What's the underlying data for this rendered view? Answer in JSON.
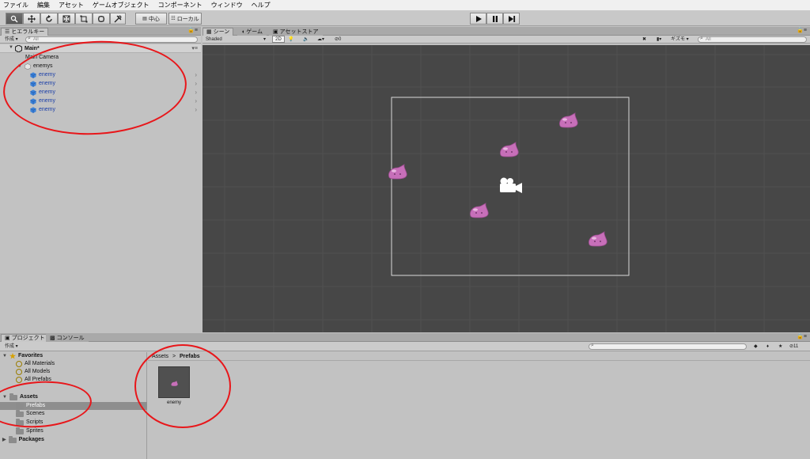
{
  "menubar": [
    "ファイル",
    "編集",
    "アセット",
    "ゲームオブジェクト",
    "コンポーネント",
    "ウィンドウ",
    "ヘルプ"
  ],
  "toolbar": {
    "pivot_label": "中心",
    "space_label": "ローカル",
    "play_icon": "play-icon",
    "pause_icon": "pause-icon",
    "step_icon": "step-icon"
  },
  "hierarchy": {
    "tab_label": "ヒエラルキー",
    "create_label": "作成",
    "search_placeholder": "All",
    "scene_name": "Main*",
    "items": [
      "Main Camera",
      "enemys",
      "enemy",
      "enemy",
      "enemy",
      "enemy",
      "enemy"
    ]
  },
  "scene_view": {
    "tabs": [
      "シーン",
      "ゲーム",
      "アセットストア"
    ],
    "shading": "Shaded",
    "mode_2d": "2D",
    "gizmo_value": "0",
    "gizmos_label": "ギズモ",
    "search_placeholder": "All"
  },
  "project": {
    "tabs": [
      "プロジェクト",
      "コンソール"
    ],
    "create_label": "作成",
    "hidden_count": "11",
    "favorites_label": "Favorites",
    "favorites": [
      "All Materials",
      "All Models",
      "All Prefabs"
    ],
    "assets_label": "Assets",
    "asset_folders": [
      "Prefabs",
      "Scenes",
      "Scripts",
      "Sprites"
    ],
    "packages_label": "Packages",
    "breadcrumb": [
      "Assets",
      "Prefabs"
    ],
    "breadcrumb_sep": ">",
    "prefab_name": "enemy"
  },
  "colors": {
    "annotation_red": "#e8161a",
    "scene_bg": "#474747",
    "selection": "#8e8e8e",
    "slime": "#c76fb9"
  }
}
